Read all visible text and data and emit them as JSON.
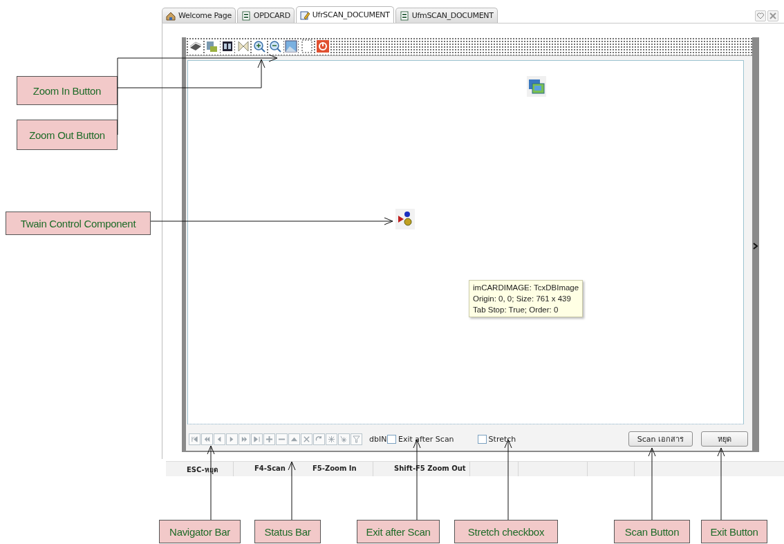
{
  "tabs": [
    {
      "label": "Welcome Page",
      "kind": "home",
      "selected": false
    },
    {
      "label": "OPDCARD",
      "kind": "form",
      "selected": false
    },
    {
      "label": "UfrSCAN_DOCUMENT",
      "kind": "unit",
      "selected": true
    },
    {
      "label": "UfmSCAN_DOCUMENT",
      "kind": "form",
      "selected": false
    }
  ],
  "tooltip": [
    "imCARDIMAGE: TcxDBImage",
    "Origin: 0, 0; Size: 761 x 439",
    "Tab Stop: True; Order: 0"
  ],
  "label_fragment": "dbIN",
  "checkboxes": [
    {
      "label": "Exit after Scan",
      "checked": false
    },
    {
      "label": "Stretch",
      "checked": false
    }
  ],
  "buttons": [
    "Scan เอกสาร",
    "หยุด"
  ],
  "status_bar": [
    "ESC-หยุด",
    "F4-Scan",
    "F5-Zoom In",
    "Shift-F5 Zoom Out"
  ],
  "callouts": [
    "Zoom In Button",
    "Zoom Out Button",
    "Twain Control Component",
    "Navigator Bar",
    "Status Bar",
    "Exit after Scan",
    "Stretch checkbox",
    "Scan Button",
    "Exit Button"
  ]
}
